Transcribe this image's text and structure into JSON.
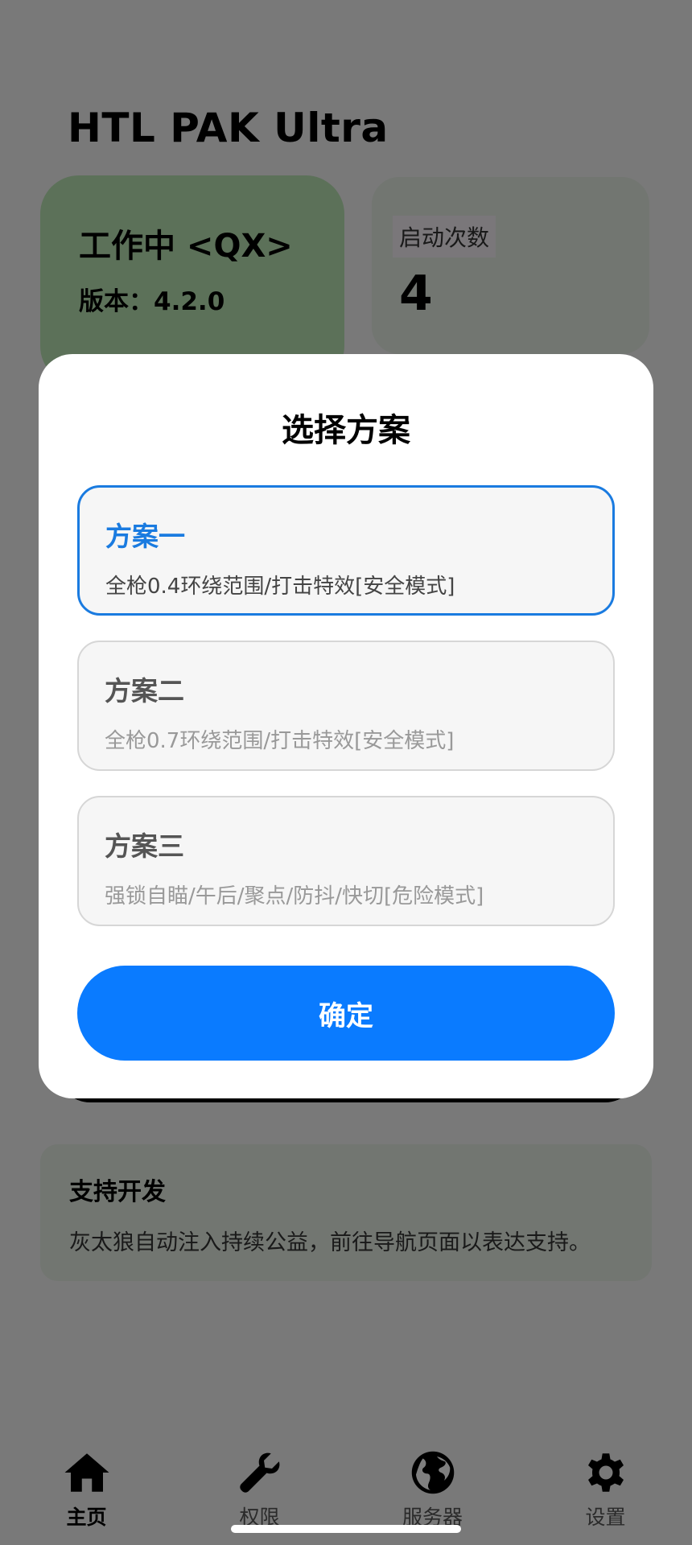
{
  "app": {
    "title": "HTL PAK Ultra",
    "status_card": {
      "title": "工作中 <QX>",
      "version": "版本：4.2.0",
      "color": "#b9e3b3"
    },
    "count_card": {
      "label": "启动次数",
      "value": "4"
    },
    "support_card": {
      "title": "支持开发",
      "text": "灰太狼自动注入持续公益，前往导航页面以表达支持。"
    }
  },
  "nav": {
    "items": [
      {
        "label": "主页",
        "icon": "home-icon",
        "active": true
      },
      {
        "label": "权限",
        "icon": "wrench-icon",
        "active": false
      },
      {
        "label": "服务器",
        "icon": "globe-icon",
        "active": false
      },
      {
        "label": "设置",
        "icon": "gear-icon",
        "active": false
      }
    ]
  },
  "dialog": {
    "title": "选择方案",
    "options": [
      {
        "title": "方案一",
        "desc": "全枪0.4环绕范围/打击特效[安全模式]",
        "selected": true
      },
      {
        "title": "方案二",
        "desc": "全枪0.7环绕范围/打击特效[安全模式]",
        "selected": false
      },
      {
        "title": "方案三",
        "desc": "强锁自瞄/午后/聚点/防抖/快切[危险模式]",
        "selected": false
      }
    ],
    "confirm_label": "确定",
    "accent_color": "#0a7bff"
  }
}
